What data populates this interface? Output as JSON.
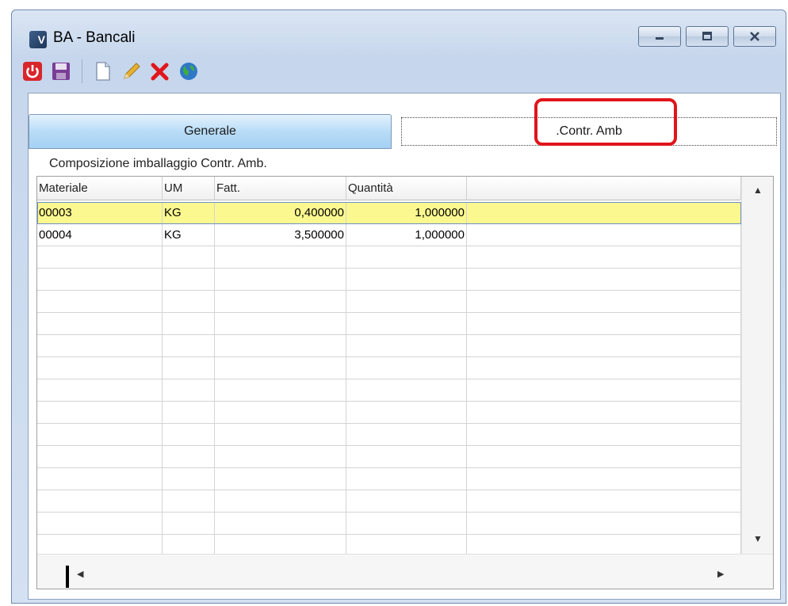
{
  "window": {
    "title": "BA - Bancali",
    "app_icon_letter": "V",
    "minimize_icon": "minimize-icon",
    "maximize_icon": "maximize-icon",
    "close_icon": "close-icon"
  },
  "toolbar": {
    "items": [
      "power-icon",
      "save-icon",
      "new-document-icon",
      "edit-pencil-icon",
      "delete-x-icon",
      "globe-icon"
    ]
  },
  "tabs": [
    {
      "label": "Generale",
      "active": false
    },
    {
      "label": ".Contr. Amb",
      "active": true
    }
  ],
  "section": {
    "label": "Composizione imballaggio Contr. Amb."
  },
  "grid": {
    "columns": [
      "Materiale",
      "UM",
      "Fatt.",
      "Quantità"
    ],
    "rows": [
      {
        "materiale": "00003",
        "um": "KG",
        "fatt": "0,400000",
        "quantita": "1,000000"
      },
      {
        "materiale": "00004",
        "um": "KG",
        "fatt": "3,500000",
        "quantita": "1,000000"
      }
    ],
    "selected_row": 0,
    "selected_row_color": "#fbf890"
  },
  "colors": {
    "highlight_box": "#e0151a",
    "tab_active_blue": "#b8dcf7",
    "window_frame": "#c6d6ec"
  }
}
